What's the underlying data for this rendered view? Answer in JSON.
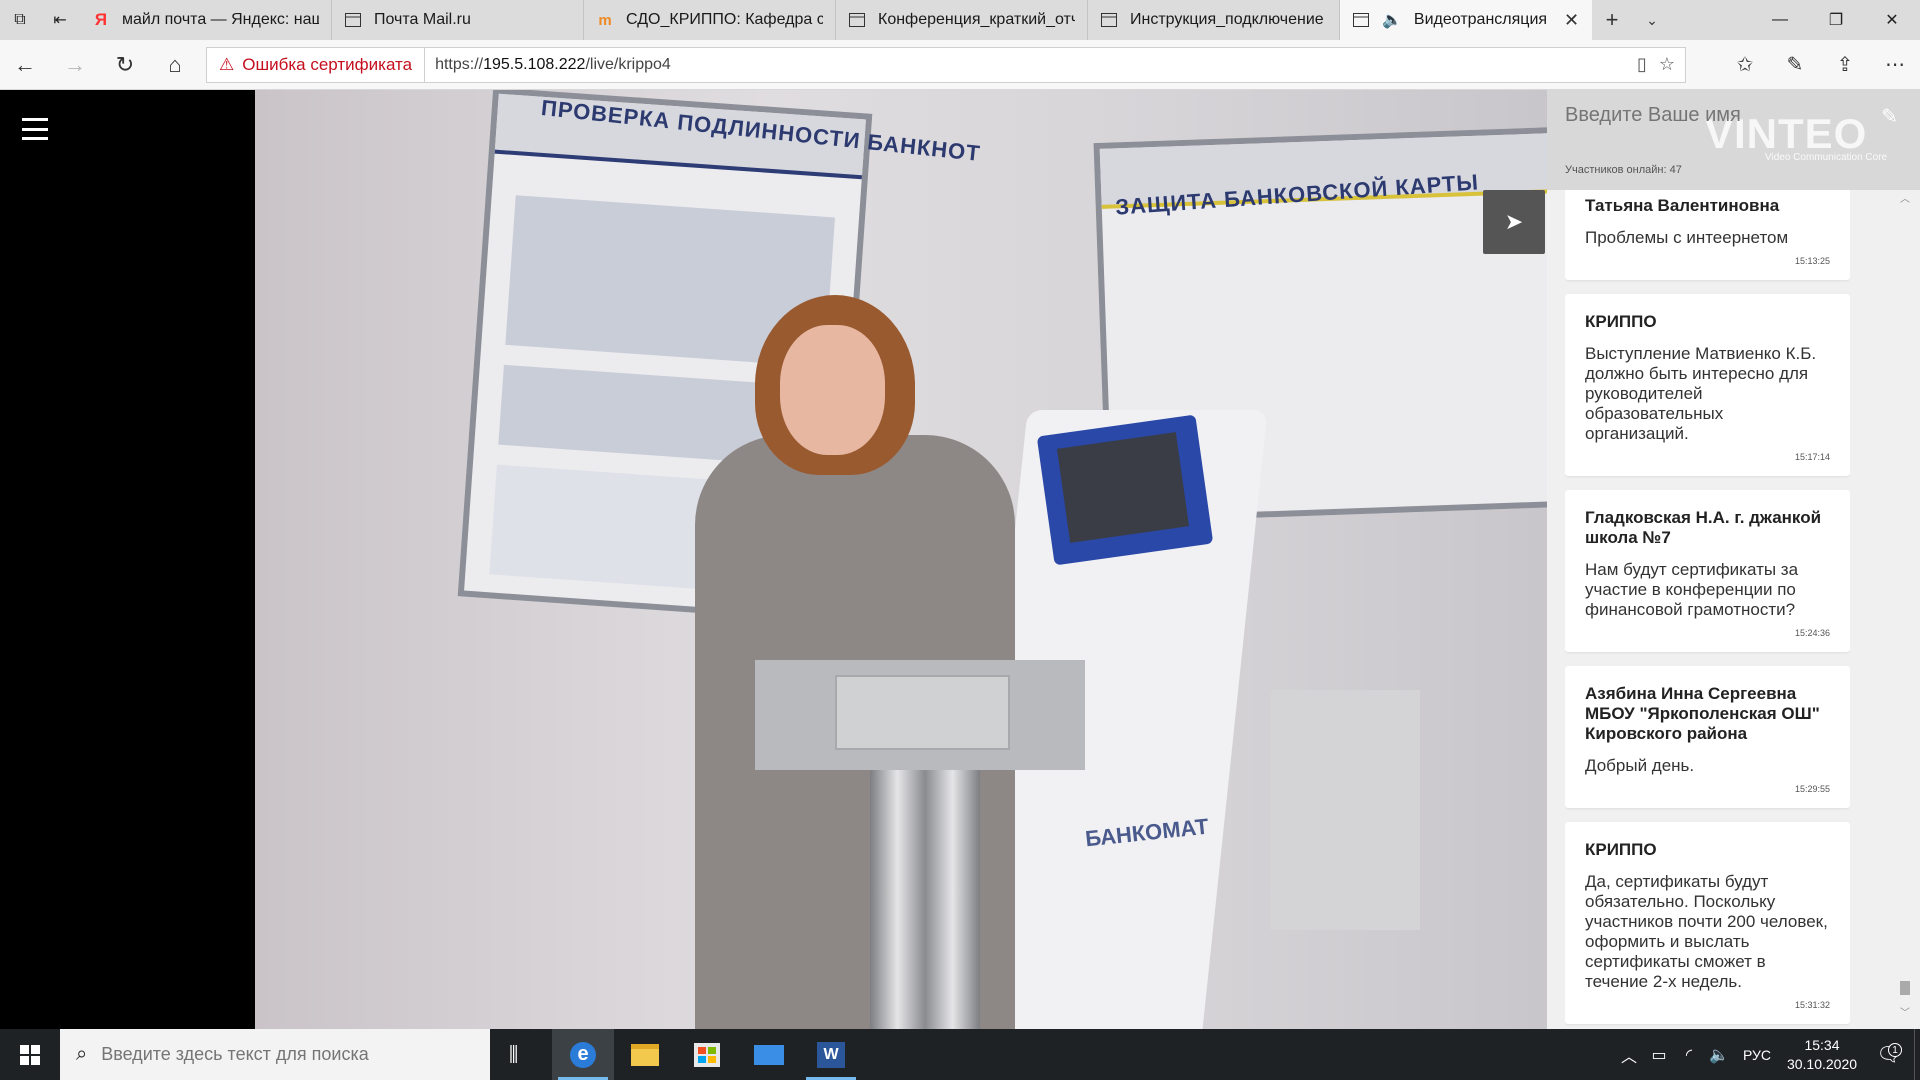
{
  "browser": {
    "tabs": [
      {
        "label": "майл почта — Яндекс: нашлось",
        "icon": "yandex-icon"
      },
      {
        "label": "Почта Mail.ru",
        "icon": "page-icon"
      },
      {
        "label": "СДО_КРИППО: Кафедра социально",
        "icon": "moodle-icon"
      },
      {
        "label": "Конференция_краткий_отчет",
        "icon": "page-icon"
      },
      {
        "label": "Инструкция_подключение",
        "icon": "page-icon"
      },
      {
        "label": "Видеотрансляция - Vinteo",
        "icon": "page-icon",
        "active": true
      }
    ],
    "cert_error": "Ошибка сертификата",
    "url_scheme": "https://",
    "url_host": "195.5.108.222",
    "url_path": "/live/krippo4"
  },
  "chat": {
    "name_placeholder": "Введите Ваше имя",
    "brand": "VINTEO",
    "brand_sub": "Video Communication Core",
    "online": "Участников онлайн: 47",
    "messages": [
      {
        "author": "Борисова Наталья Татьяна Валентиновна",
        "author_visible": "Татьяна Валентиновна",
        "text": "Проблемы с интеернетом",
        "time": "15:13:25"
      },
      {
        "author": "КРИППО",
        "text": "Выступление Матвиенко К.Б. должно быть интересно для руководителей образовательных организаций.",
        "time": "15:17:14"
      },
      {
        "author": "Гладковская Н.А. г. джанкой школа №7",
        "text": "Нам будут сертификаты за участие в конференции по финансовой грамотности?",
        "time": "15:24:36"
      },
      {
        "author": "Азябина Инна Сергеевна МБОУ \"Яркополенская ОШ\" Кировского района",
        "text": "Добрый день.",
        "time": "15:29:55"
      },
      {
        "author": "КРИППО",
        "text": "Да, сертификаты будут обязательно. Поскольку участников  почти 200 человек, оформить и выслать сертификаты сможет в течение 2-х недель.",
        "time": "15:31:32"
      }
    ]
  },
  "video": {
    "poster1_title": "ПРОВЕРКА ПОДЛИННОСТИ БАНКНОТ",
    "poster2_title": "ЗАЩИТА БАНКОВСКОЙ КАРТЫ",
    "atm_label": "БАНКОМАТ"
  },
  "taskbar": {
    "search_placeholder": "Введите здесь текст для поиска",
    "lang": "РУС",
    "time": "15:34",
    "date": "30.10.2020",
    "notifications": "1"
  }
}
